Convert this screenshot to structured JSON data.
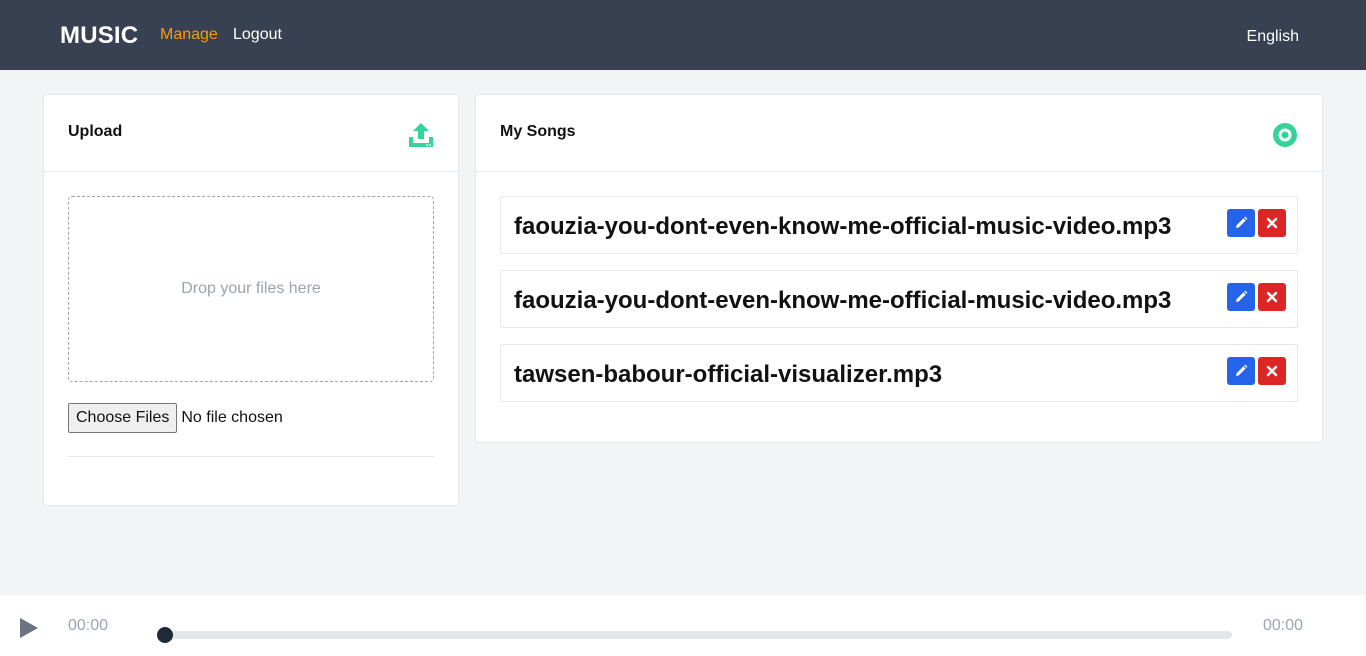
{
  "nav": {
    "brand": "MUSIC",
    "manage": "Manage",
    "logout": "Logout",
    "language": "English"
  },
  "upload": {
    "title": "Upload",
    "icon": "upload-icon",
    "dropzone_text": "Drop your files here",
    "choose_button": "Choose Files",
    "no_file_text": "No file chosen"
  },
  "songs": {
    "title": "My Songs",
    "icon": "disc-icon",
    "items": [
      {
        "name": "faouzia-you-dont-even-know-me-official-music-video.mp3"
      },
      {
        "name": "faouzia-you-dont-even-know-me-official-music-video.mp3"
      },
      {
        "name": "tawsen-babour-official-visualizer.mp3"
      }
    ]
  },
  "player": {
    "current_time": "00:00",
    "duration": "00:00",
    "progress": 0
  },
  "colors": {
    "navbar": "#374151",
    "accent": "#f59e0b",
    "icon_green": "#34d399",
    "edit": "#2563eb",
    "delete": "#dc2626"
  }
}
